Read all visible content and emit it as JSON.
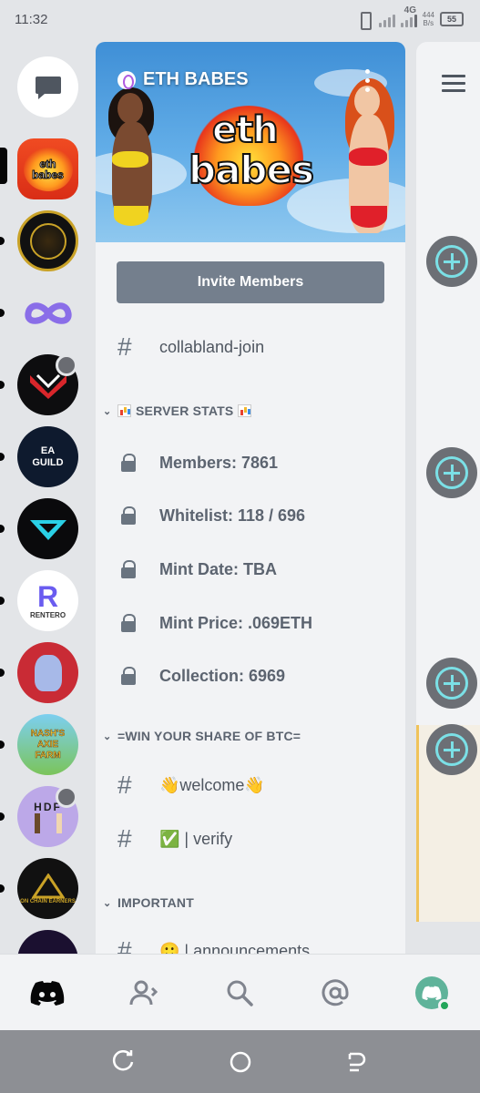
{
  "status_bar": {
    "time": "11:32",
    "network": "4G",
    "speed_value": "444",
    "speed_unit": "B/s",
    "battery": "55"
  },
  "rail": {
    "dm_icon": "chat-bubble-icon",
    "servers": [
      {
        "name": "eth babes",
        "logo_text": "eth babes",
        "selected": true
      },
      {
        "name": "gold ape",
        "logo_text": ""
      },
      {
        "name": "infinity",
        "logo_text": ""
      },
      {
        "name": "chevron",
        "logo_text": ""
      },
      {
        "name": "ea guild",
        "logo_text": "EA GUILD"
      },
      {
        "name": "wing",
        "logo_text": ""
      },
      {
        "name": "rentero",
        "logo_text": "RENTERO"
      },
      {
        "name": "rabbit",
        "logo_text": ""
      },
      {
        "name": "nashs axie farm",
        "logo_text": "NASH'S AXIE FARM"
      },
      {
        "name": "hdf",
        "logo_text": "HDF"
      },
      {
        "name": "on chain earners",
        "logo_text": "ON CHAIN EARNERS"
      },
      {
        "name": "partial",
        "logo_text": ""
      }
    ]
  },
  "server": {
    "name": "ETH BABES",
    "banner_text_1": "eth",
    "banner_text_2": "babes",
    "invite_label": "Invite Members"
  },
  "channels": {
    "top": {
      "name": "collabland-join"
    },
    "categories": [
      {
        "title": "SERVER STATS",
        "items": [
          {
            "label": "Members: 7861"
          },
          {
            "label": "Whitelist: 118 / 696"
          },
          {
            "label": "Mint Date: TBA"
          },
          {
            "label": "Mint Price: .069ETH"
          },
          {
            "label": "Collection: 6969"
          }
        ]
      },
      {
        "title": "=WIN YOUR SHARE OF BTC=",
        "items": [
          {
            "label": "👋welcome👋"
          },
          {
            "label": "✅ | verify"
          }
        ]
      },
      {
        "title": "IMPORTANT",
        "items": [
          {
            "label": "🙂 | announcements"
          }
        ]
      }
    ]
  },
  "bottom_nav": {
    "items": [
      "discord-home-icon",
      "friends-icon",
      "search-icon",
      "mentions-icon",
      "profile-avatar"
    ]
  },
  "colors": {
    "accent_add": "#7be0e6",
    "invite_bg": "#747f8d",
    "panel_bg": "#f2f3f5",
    "rail_bg": "#e3e5e8"
  }
}
